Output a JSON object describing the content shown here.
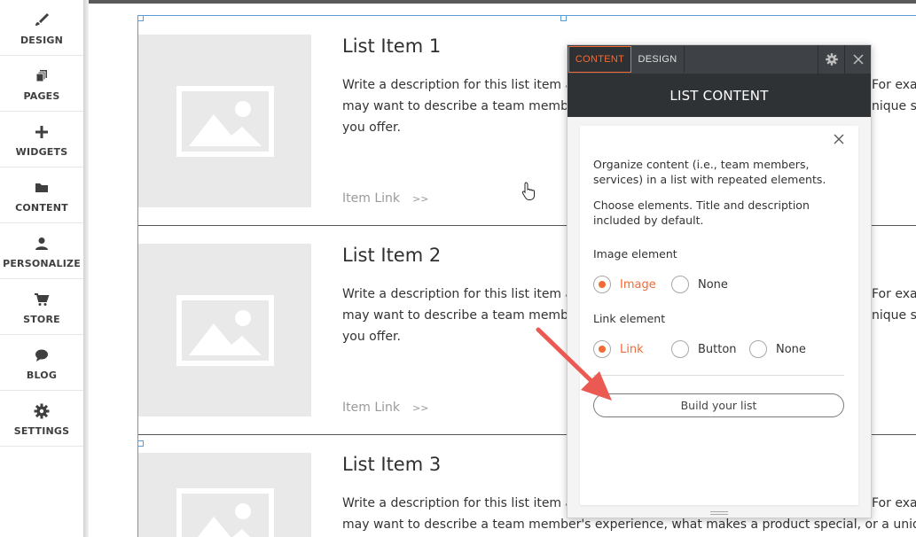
{
  "sidebar": {
    "items": [
      {
        "label": "DESIGN",
        "icon": "brush-icon"
      },
      {
        "label": "PAGES",
        "icon": "pages-icon"
      },
      {
        "label": "WIDGETS",
        "icon": "plus-icon"
      },
      {
        "label": "CONTENT",
        "icon": "folder-icon"
      },
      {
        "label": "PERSONALIZE",
        "icon": "person-icon"
      },
      {
        "label": "STORE",
        "icon": "cart-icon"
      },
      {
        "label": "BLOG",
        "icon": "chat-bubble-icon"
      },
      {
        "label": "SETTINGS",
        "icon": "gear-icon"
      }
    ]
  },
  "list_items": [
    {
      "title": "List Item 1",
      "desc_line1": "Write a description for this list item an",
      "desc_line2": "may want to describe a team member",
      "desc_line3": "you offer.",
      "right_line1": "For exar",
      "right_line2": "nique se",
      "link_label": "Item Link",
      "link_arrow": ">>"
    },
    {
      "title": "List Item 2",
      "desc_line1": "Write a description for this list item an",
      "desc_line2": "may want to describe a team member",
      "desc_line3": "you offer.",
      "right_line1": "For exar",
      "right_line2": "nique se",
      "link_label": "Item Link",
      "link_arrow": ">>"
    },
    {
      "title": "List Item 3",
      "desc_line1": "Write a description for this list item an",
      "desc_line2": "may want to describe a team member's experience, what makes a product special, or a unique se",
      "right_line1": "For exar"
    }
  ],
  "panel": {
    "tabs": {
      "content": "CONTENT",
      "design": "DESIGN"
    },
    "header": "LIST CONTENT",
    "intro": "Organize content (i.e., team members, services) in a list with repeated elements.",
    "choose": "Choose elements. Title and description included by default.",
    "image_group": {
      "label": "Image element",
      "options": [
        "Image",
        "None"
      ],
      "selected": "Image"
    },
    "link_group": {
      "label": "Link element",
      "options": [
        "Link",
        "Button",
        "None"
      ],
      "selected": "Link"
    },
    "build_button": "Build your list"
  },
  "colors": {
    "accent": "#f26a36",
    "panel_dark": "#2f3235",
    "selection": "#5b9bd5",
    "arrow": "#ea5a52"
  }
}
